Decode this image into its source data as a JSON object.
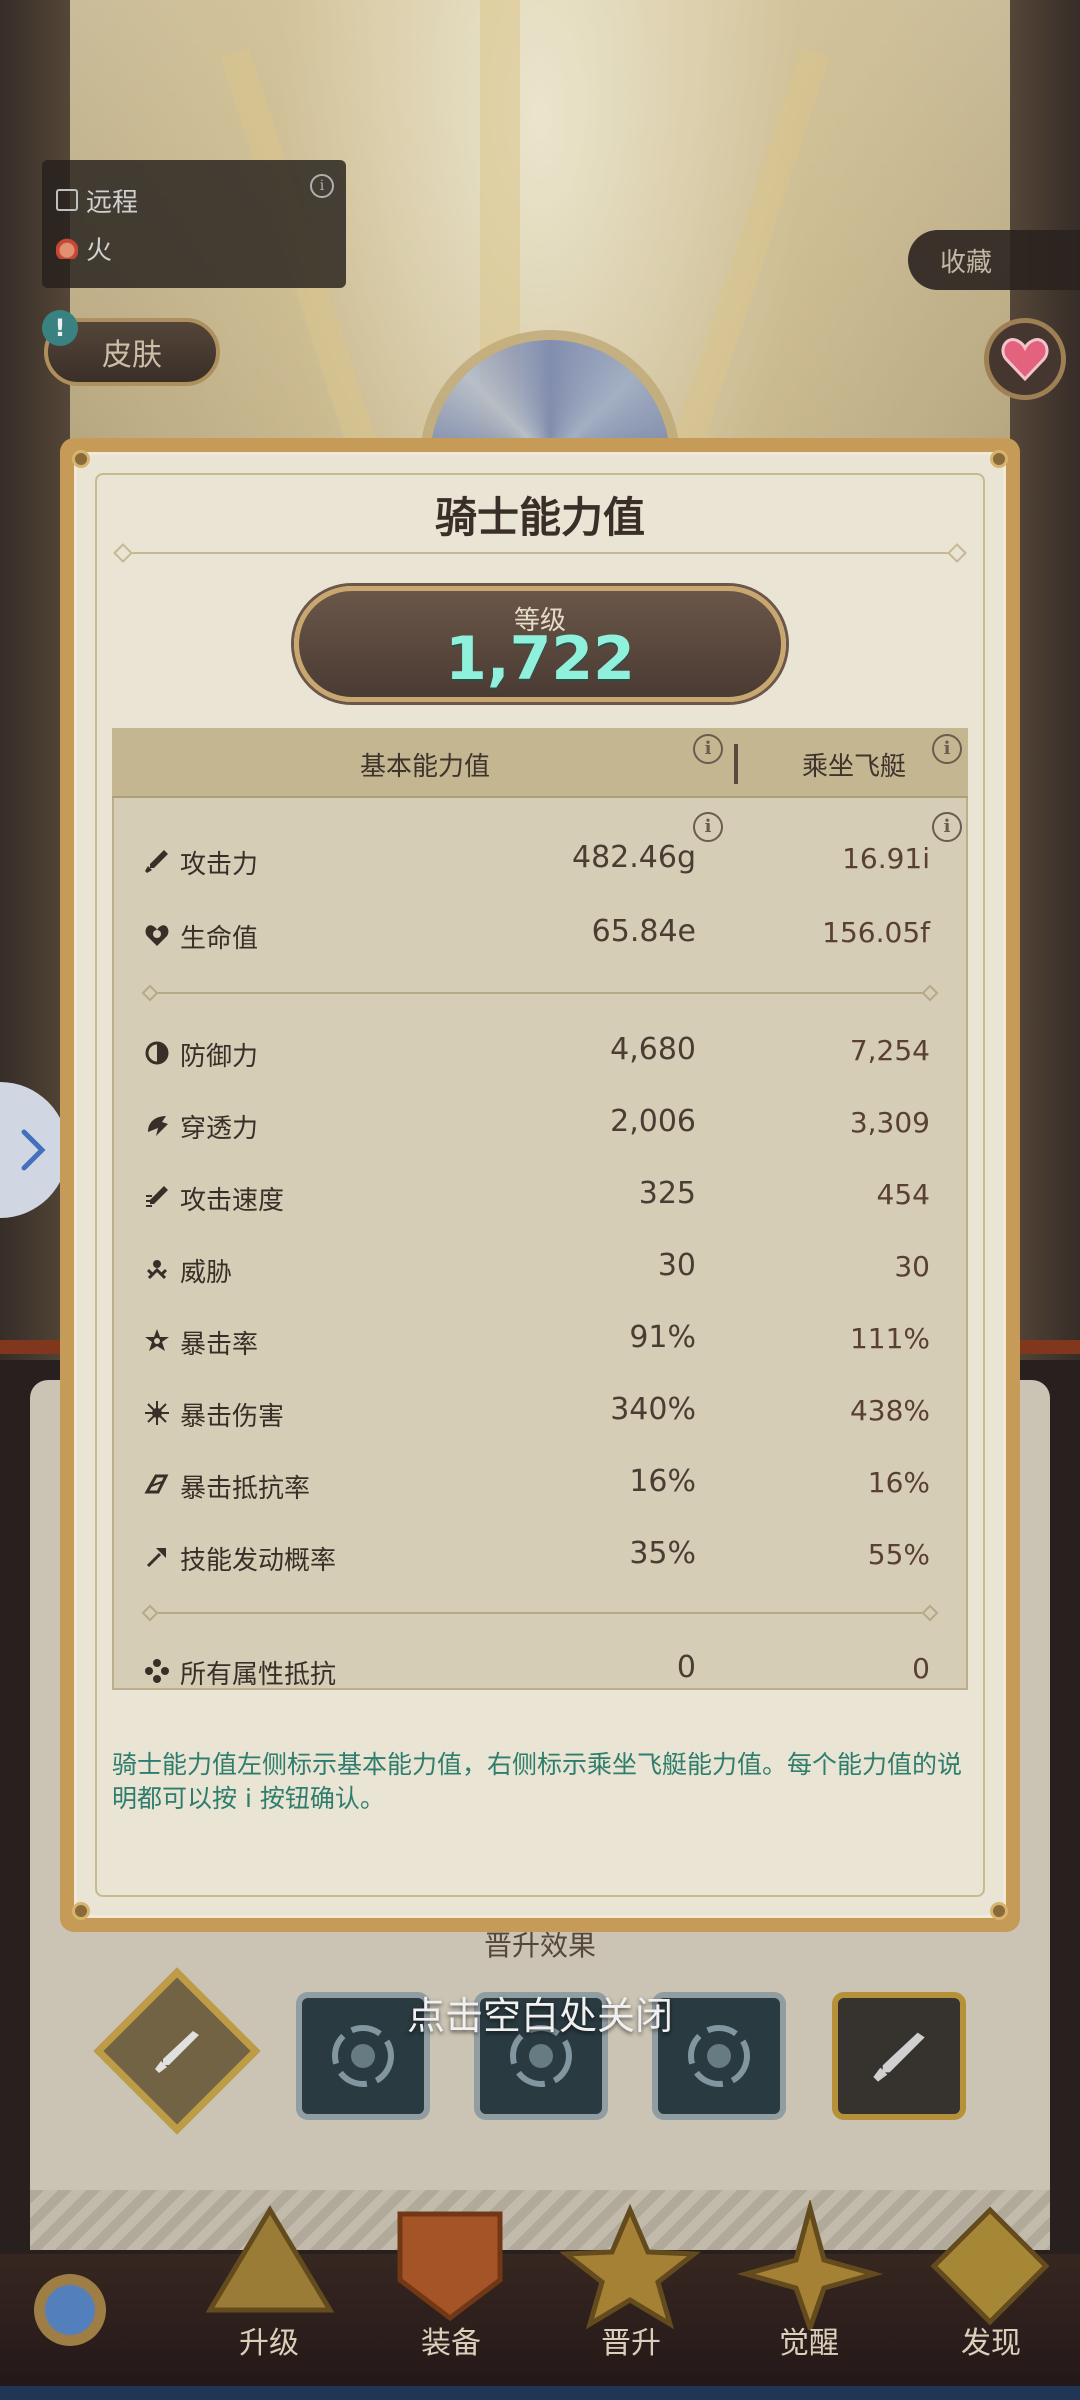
{
  "background": {
    "attack_type": "远程",
    "element": "火",
    "skin_button": "皮肤",
    "favorite_button": "收藏",
    "promo_title": "晋升效果"
  },
  "modal": {
    "title": "骑士能力值",
    "level_label": "等级",
    "level_value": "1,722",
    "header_base": "基本能力值",
    "header_mount": "乘坐飞艇",
    "stats": [
      {
        "icon": "sword-icon",
        "name": "攻击力",
        "base": "482.46g",
        "mount": "16.91i"
      },
      {
        "icon": "heart-shield-icon",
        "name": "生命值",
        "base": "65.84e",
        "mount": "156.05f"
      },
      {
        "icon": "defense-icon",
        "name": "防御力",
        "base": "4,680",
        "mount": "7,254"
      },
      {
        "icon": "penetration-icon",
        "name": "穿透力",
        "base": "2,006",
        "mount": "3,309"
      },
      {
        "icon": "attack-speed-icon",
        "name": "攻击速度",
        "base": "325",
        "mount": "454"
      },
      {
        "icon": "threat-icon",
        "name": "威胁",
        "base": "30",
        "mount": "30"
      },
      {
        "icon": "crit-rate-icon",
        "name": "暴击率",
        "base": "91%",
        "mount": "111%"
      },
      {
        "icon": "crit-damage-icon",
        "name": "暴击伤害",
        "base": "340%",
        "mount": "438%"
      },
      {
        "icon": "crit-resist-icon",
        "name": "暴击抵抗率",
        "base": "16%",
        "mount": "16%"
      },
      {
        "icon": "skill-trigger-icon",
        "name": "技能发动概率",
        "base": "35%",
        "mount": "55%"
      },
      {
        "icon": "all-resist-icon",
        "name": "所有属性抵抗",
        "base": "0",
        "mount": "0"
      }
    ],
    "note": "骑士能力值左侧标示基本能力值，右侧标示乘坐飞艇能力值。每个能力值的说明都可以按 i 按钮确认。",
    "close_hint": "点击空白处关闭"
  },
  "bottom_nav": {
    "items": [
      "升级",
      "装备",
      "晋升",
      "觉醒",
      "发现"
    ]
  },
  "colors": {
    "level_value": "#8ff0dc",
    "note_text": "#2e7d6d",
    "modal_frame": "#c59b57"
  }
}
